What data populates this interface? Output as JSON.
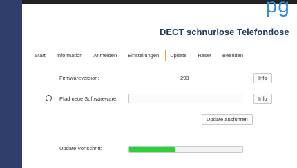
{
  "header": {
    "title": "DECT schnurlose Telefondose"
  },
  "corner_fragment": "pg",
  "tabs": [
    {
      "label": "Start"
    },
    {
      "label": "Information"
    },
    {
      "label": "Anmelden"
    },
    {
      "label": "Einstellungen"
    },
    {
      "label": "Update",
      "active": true
    },
    {
      "label": "Reset"
    },
    {
      "label": "Beenden"
    }
  ],
  "firmware": {
    "label": "Firmwareversion:",
    "value": "293",
    "info_button": "Info"
  },
  "software_path": {
    "label": "Pfad neue Softwareware:",
    "value": "",
    "info_button": "Info"
  },
  "update": {
    "button": "Update ausführen"
  },
  "progress": {
    "label": "Update Vortschritt:",
    "value_percent": 40,
    "fill_color": "#2bd03b"
  },
  "colors": {
    "sidebar": "#2f3e6b",
    "header_title": "#1f3a63",
    "active_tab_border": "#f2a03d"
  }
}
